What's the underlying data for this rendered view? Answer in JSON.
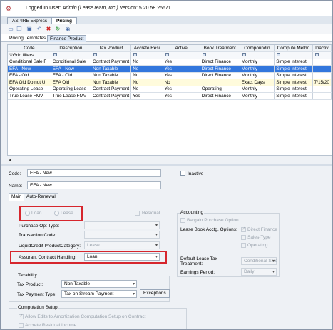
{
  "header": {
    "logged_in_label": "Logged In User:",
    "user": "Admin  (LeaseTeam, Inc.)",
    "version": "Version:  5.20.58.25671"
  },
  "tabs": [
    "ASPIRE Express",
    "Pricing"
  ],
  "subtabs": [
    "Pricing Templates",
    "Finance Product"
  ],
  "grid": {
    "columns": [
      "Code",
      "Description",
      "Tax Product",
      "Accrete Resi",
      "Active",
      "Book Treatment",
      "Compoundin",
      "Compute Metho",
      "Inactiv"
    ],
    "filter_text": "Grid filters...",
    "rows": [
      [
        "Conditional Sale F",
        "Conditional Sale",
        "Contract Payment",
        "No",
        "Yes",
        "Direct Finance",
        "Monthly",
        "Simple Interest",
        ""
      ],
      [
        "EFA - New",
        "EFA - New",
        "Non Taxable",
        "No",
        "Yes",
        "Direct Finance",
        "Monthly",
        "Simple Interest",
        ""
      ],
      [
        "EFA - Old",
        "EFA - Old",
        "Non Taxable",
        "No",
        "Yes",
        "Direct Finance",
        "Monthly",
        "Simple Interest",
        ""
      ],
      [
        "EFA Old Do not U",
        "EFA Old",
        "Non Taxable",
        "No",
        "No",
        "",
        "Exact Days",
        "Simple Interest",
        "7/15/20"
      ],
      [
        "Operating Lease",
        "Operating Lease",
        "Contract Payment",
        "No",
        "Yes",
        "Operating",
        "Monthly",
        "Simple Interest",
        ""
      ],
      [
        "True Lease FMV",
        "True Lease FMV",
        "Contract Payment",
        "Yes",
        "Yes",
        "Direct Finance",
        "Monthly",
        "Simple Interest",
        ""
      ]
    ]
  },
  "form": {
    "code_label": "Code:",
    "code_value": "EFA - New",
    "name_label": "Name:",
    "name_value": "EFA - New",
    "inactive_label": "Inactive",
    "tabs": [
      "Main",
      "Auto-Renewal"
    ],
    "loan_label": "Loan",
    "lease_label": "Lease",
    "residual_label": "Residual",
    "purchase_opt_label": "Purchase Opt Type:",
    "transaction_code_label": "Transaction Code:",
    "liquid_credit_label": "LiquidCredit ProductCategory:",
    "liquid_credit_value": "Lease",
    "assurant_label": "Assurant Contract Handling:",
    "assurant_value": "Loan",
    "accounting_title": "Accounting",
    "bargain_label": "Bargain Purchase Option",
    "book_accounting_label": "Lease Book Acctg. Options:",
    "direct_finance": "Direct Finance",
    "sales_type": "Sales-Type",
    "operating": "Operating",
    "default_tax_label": "Default Lease Tax\nTreatment:",
    "default_tax_value": "Conditional Sale",
    "earnings_label": "Earnings Period:",
    "earnings_value": "Daily",
    "taxability_title": "Taxability",
    "tax_product_label": "Tax Product:",
    "tax_product_value": "Non Taxable",
    "tax_payment_label": "Tax Payment Type:",
    "tax_payment_value": "Tax on Stream Payment",
    "exceptions_label": "Exceptions",
    "computation_title": "Computation Setup",
    "allow_edits_label": "Allow Edits to Amortization Computation Setup on Contract",
    "accrete_label": "Accrete Residual Income"
  },
  "colors": {
    "selected_row": "#3377dd",
    "highlight_box": "#d6262d",
    "inactive_row": "#fffbdc"
  }
}
